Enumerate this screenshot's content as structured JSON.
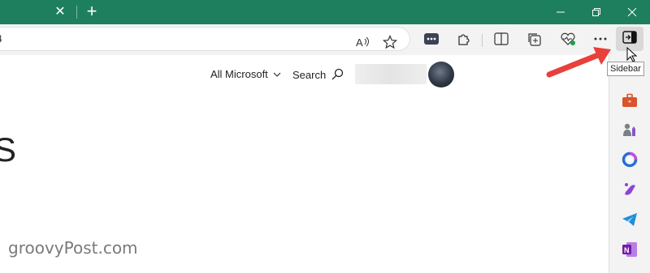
{
  "window": {
    "titlebar_color": "#1e7f5e",
    "tab_close_icon": "close-icon",
    "new_tab_icon": "plus-icon",
    "controls": [
      "minimize-icon",
      "restore-icon",
      "close-icon"
    ]
  },
  "toolbar": {
    "address_text": "4",
    "icons": [
      "read-aloud-icon",
      "favorite-star-icon",
      "extension-badge-icon",
      "extensions-puzzle-icon",
      "split-screen-icon",
      "collections-icon",
      "browser-essentials-icon",
      "more-menu-icon",
      "sidebar-toggle-icon"
    ]
  },
  "page": {
    "nav_all_microsoft": "All Microsoft",
    "nav_search": "Search",
    "partial_heading": "S"
  },
  "tooltip": {
    "text": "Sidebar"
  },
  "sidebar_icons": [
    "tools-briefcase-icon",
    "games-chess-icon",
    "microsoft-365-icon",
    "drop-icon",
    "telegram-icon",
    "onenote-icon"
  ],
  "watermark": "groovyPost.com",
  "accent": {
    "annotation_arrow": "#e8403a"
  }
}
